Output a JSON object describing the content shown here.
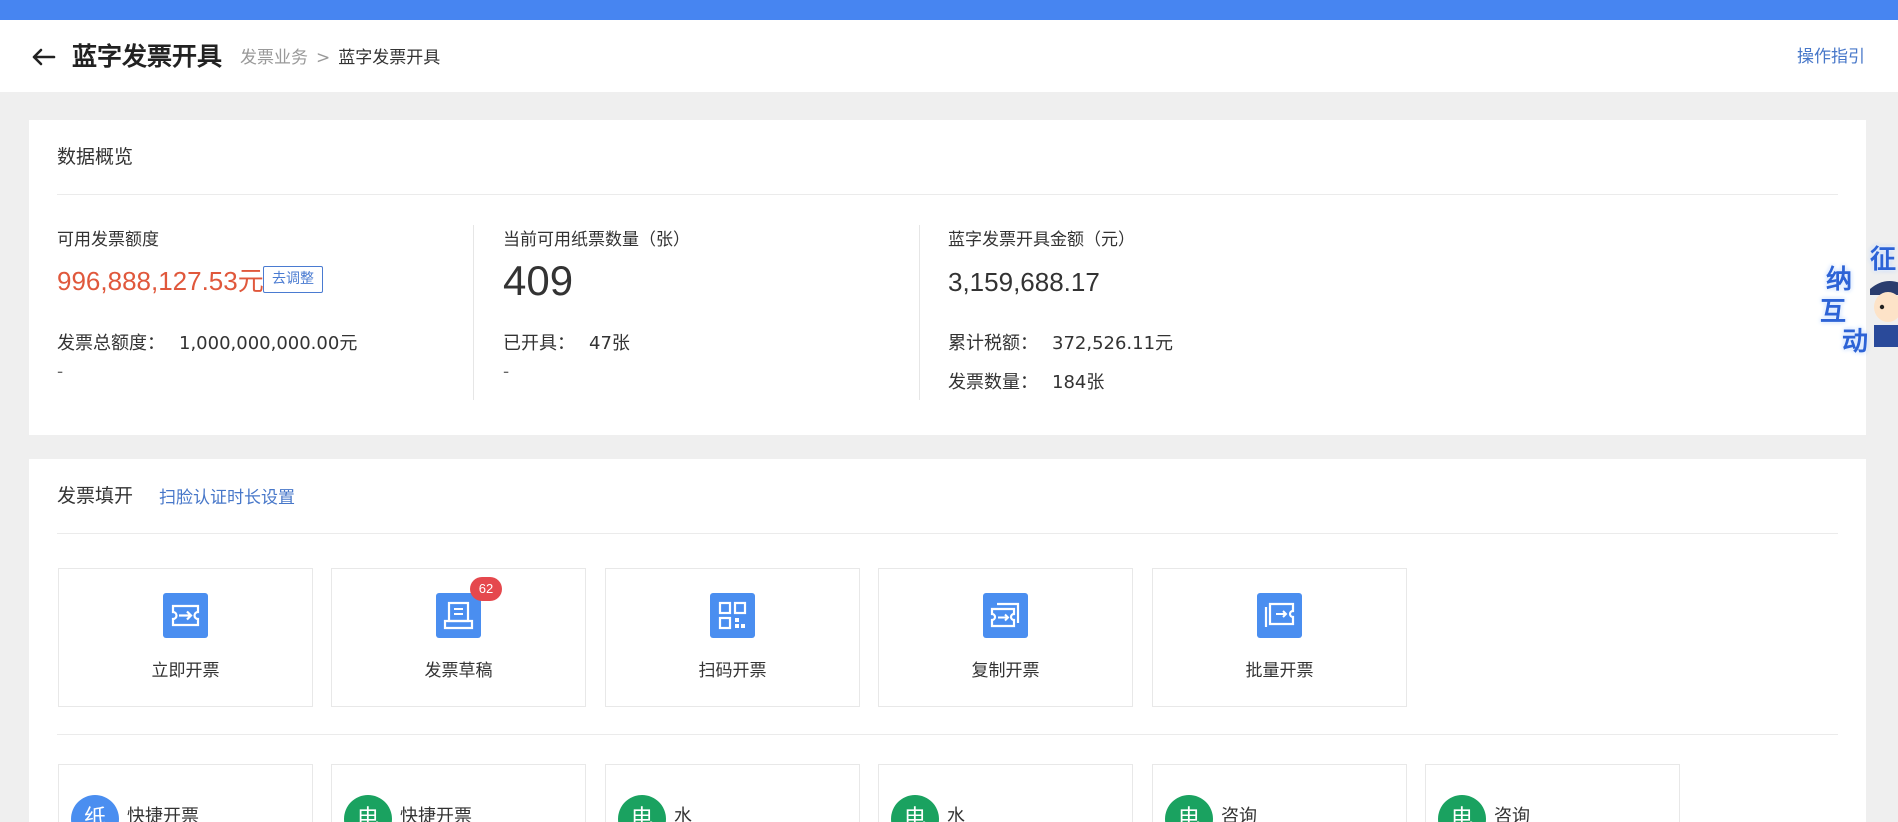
{
  "header": {
    "title": "蓝字发票开具",
    "breadcrumb": {
      "parent": "发票业务",
      "separator": ">",
      "current": "蓝字发票开具"
    },
    "guide_link": "操作指引"
  },
  "overview": {
    "title": "数据概览",
    "quota": {
      "label": "可用发票额度",
      "value": "996,888,127.53元",
      "adjust_button": "去调整",
      "total_label": "发票总额度：",
      "total_value": "1,000,000,000.00元",
      "extra": "-"
    },
    "paper": {
      "label": "当前可用纸票数量（张）",
      "value": "409",
      "issued_label": "已开具：",
      "issued_value": "47张",
      "extra": "-"
    },
    "amount": {
      "label": "蓝字发票开具金额（元）",
      "value": "3,159,688.17",
      "tax_label": "累计税额：",
      "tax_value": "372,526.11元",
      "count_label": "发票数量：",
      "count_value": "184张"
    }
  },
  "fill": {
    "title": "发票填开",
    "scan_link": "扫脸认证时长设置",
    "actions": [
      {
        "label": "立即开票",
        "icon": "ticket-arrow-icon"
      },
      {
        "label": "发票草稿",
        "icon": "draft-icon",
        "badge": "62"
      },
      {
        "label": "扫码开票",
        "icon": "qr-code-icon"
      },
      {
        "label": "复制开票",
        "icon": "copy-ticket-icon"
      },
      {
        "label": "批量开票",
        "icon": "batch-ticket-icon"
      }
    ],
    "quick": [
      {
        "tag": "纸",
        "label": "快捷开票",
        "color": "#4a8ef0"
      },
      {
        "tag": "电",
        "label": "快捷开票",
        "color": "#1aa260"
      },
      {
        "tag": "电",
        "label": "水",
        "color": "#1aa260"
      },
      {
        "tag": "电",
        "label": "水",
        "color": "#1aa260"
      },
      {
        "tag": "电",
        "label": "咨询",
        "color": "#1aa260"
      },
      {
        "tag": "电",
        "label": "咨询",
        "color": "#1aa260"
      }
    ]
  },
  "mascot": {
    "chars": [
      "征",
      "纳",
      "互",
      "动"
    ]
  },
  "colors": {
    "primary": "#4785f1",
    "accent_red": "#e0583c",
    "link": "#4777c9",
    "green": "#1aa260"
  }
}
